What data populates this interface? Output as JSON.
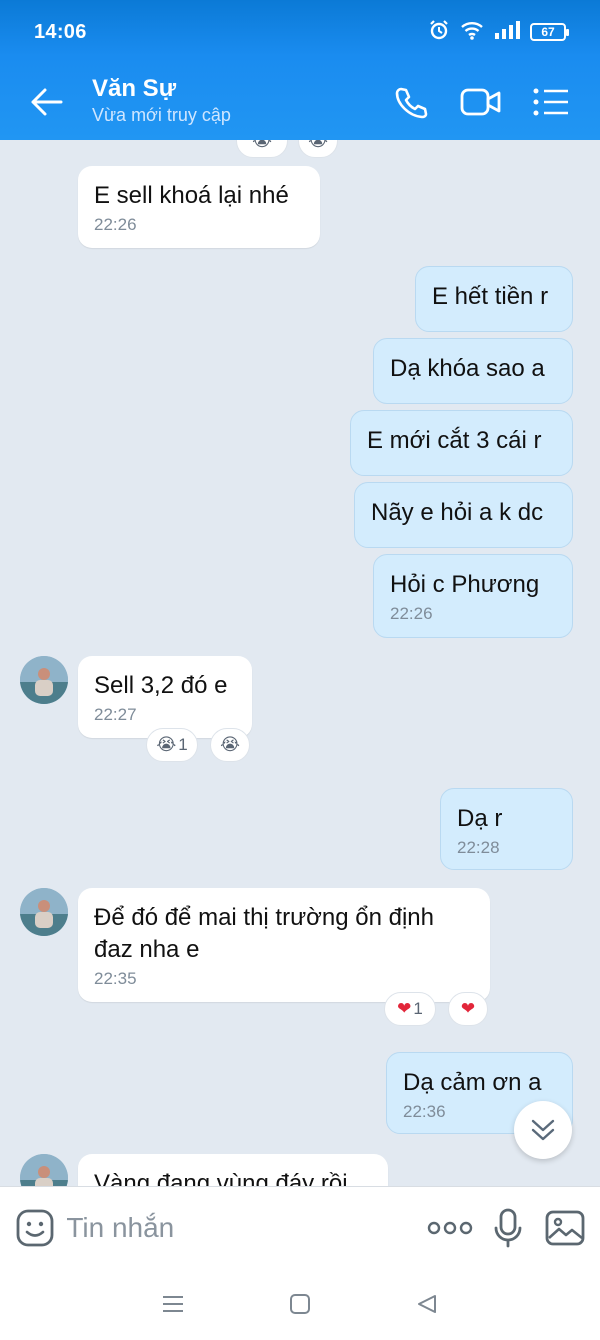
{
  "status_bar": {
    "time": "14:06",
    "battery": "67"
  },
  "header": {
    "name": "Văn Sự",
    "status": "Vừa mới truy cập"
  },
  "messages": [
    {
      "text": "E sell khoá lại nhé",
      "time": "22:26"
    },
    {
      "text": "E hết tiền r"
    },
    {
      "text": "Dạ khóa sao a"
    },
    {
      "text": "E mới cắt 3 cái r"
    },
    {
      "text": "Nãy e hỏi a k dc"
    },
    {
      "text": "Hỏi c Phương",
      "time": "22:26"
    },
    {
      "text": "Sell 3,2 đó e",
      "time": "22:27",
      "reaction_count": "1"
    },
    {
      "text": "Dạ r",
      "time": "22:28"
    },
    {
      "text": "Để đó để mai thị trường ổn định đaz nha e",
      "time": "22:35",
      "reaction_count": "1"
    },
    {
      "text": "Dạ cảm ơn a",
      "time": "22:36"
    },
    {
      "text": "Vàng đang vùng đáy rồi"
    }
  ],
  "input": {
    "placeholder": "Tin nhắn"
  },
  "colors": {
    "header": "#1a8cf0",
    "outgoing": "#d3ecfd",
    "incoming": "#ffffff",
    "chat_bg": "#e2e9f1"
  }
}
